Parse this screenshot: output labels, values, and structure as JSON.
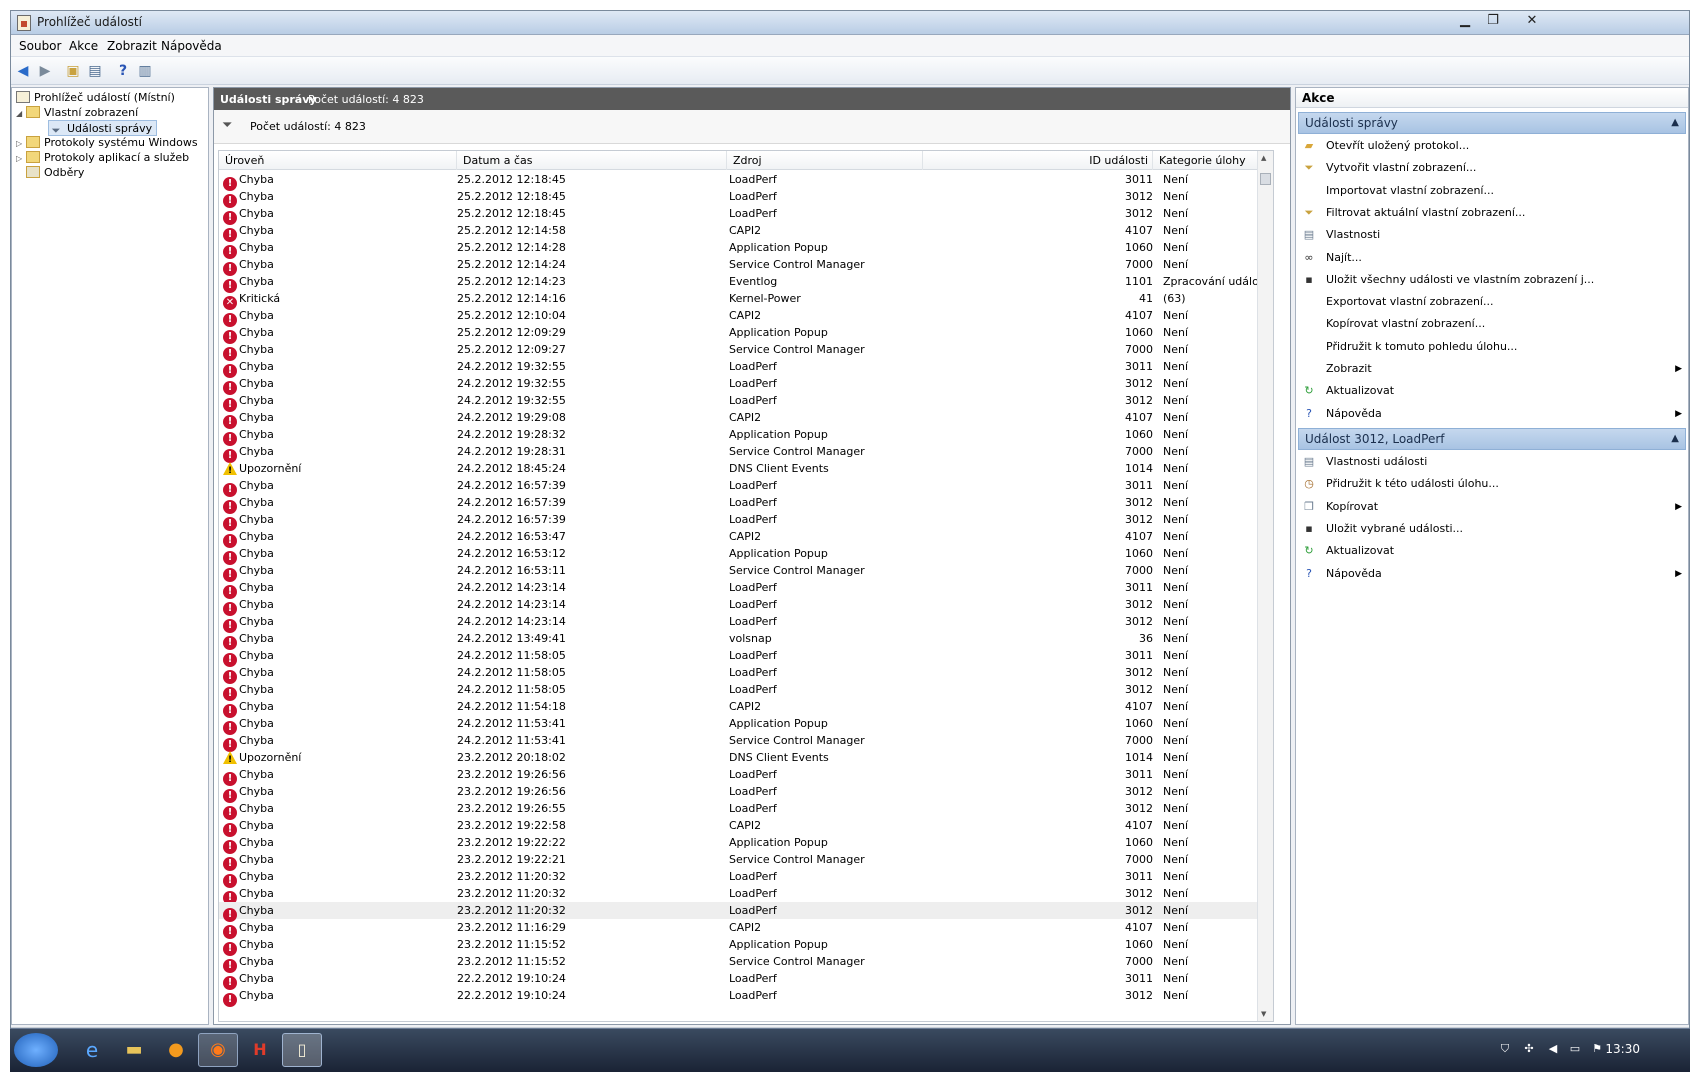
{
  "window": {
    "title": "Prohlížeč událostí",
    "minimize": "▁",
    "maximize": "❐",
    "close": "✕"
  },
  "menu": [
    "Soubor",
    "Akce",
    "Zobrazit",
    "Nápověda"
  ],
  "tree": {
    "root": "Prohlížeč událostí (Místní)",
    "custom_views": "Vlastní zobrazení",
    "admin_events": "Události správy",
    "windows_logs": "Protokoly systému Windows",
    "app_logs": "Protokoly aplikací a služeb",
    "subscriptions": "Odběry"
  },
  "middle": {
    "title": "Události správy",
    "count_header": "Počet událostí: 4 823",
    "filter_text": "Počet událostí: 4 823",
    "columns": [
      "Úroveň",
      "Datum a čas",
      "Zdroj",
      "ID události",
      "Kategorie úlohy"
    ]
  },
  "events": [
    {
      "level": "Chyba",
      "type": "err",
      "date": "25.2.2012 12:18:45",
      "source": "LoadPerf",
      "id": "3011",
      "category": "Není"
    },
    {
      "level": "Chyba",
      "type": "err",
      "date": "25.2.2012 12:18:45",
      "source": "LoadPerf",
      "id": "3012",
      "category": "Není"
    },
    {
      "level": "Chyba",
      "type": "err",
      "date": "25.2.2012 12:18:45",
      "source": "LoadPerf",
      "id": "3012",
      "category": "Není"
    },
    {
      "level": "Chyba",
      "type": "err",
      "date": "25.2.2012 12:14:58",
      "source": "CAPI2",
      "id": "4107",
      "category": "Není"
    },
    {
      "level": "Chyba",
      "type": "err",
      "date": "25.2.2012 12:14:28",
      "source": "Application Popup",
      "id": "1060",
      "category": "Není"
    },
    {
      "level": "Chyba",
      "type": "err",
      "date": "25.2.2012 12:14:24",
      "source": "Service Control Manager",
      "id": "7000",
      "category": "Není"
    },
    {
      "level": "Chyba",
      "type": "err",
      "date": "25.2.2012 12:14:23",
      "source": "Eventlog",
      "id": "1101",
      "category": "Zpracování události"
    },
    {
      "level": "Kritická",
      "type": "crit",
      "date": "25.2.2012 12:14:16",
      "source": "Kernel-Power",
      "id": "41",
      "category": "(63)"
    },
    {
      "level": "Chyba",
      "type": "err",
      "date": "25.2.2012 12:10:04",
      "source": "CAPI2",
      "id": "4107",
      "category": "Není"
    },
    {
      "level": "Chyba",
      "type": "err",
      "date": "25.2.2012 12:09:29",
      "source": "Application Popup",
      "id": "1060",
      "category": "Není"
    },
    {
      "level": "Chyba",
      "type": "err",
      "date": "25.2.2012 12:09:27",
      "source": "Service Control Manager",
      "id": "7000",
      "category": "Není"
    },
    {
      "level": "Chyba",
      "type": "err",
      "date": "24.2.2012 19:32:55",
      "source": "LoadPerf",
      "id": "3011",
      "category": "Není"
    },
    {
      "level": "Chyba",
      "type": "err",
      "date": "24.2.2012 19:32:55",
      "source": "LoadPerf",
      "id": "3012",
      "category": "Není"
    },
    {
      "level": "Chyba",
      "type": "err",
      "date": "24.2.2012 19:32:55",
      "source": "LoadPerf",
      "id": "3012",
      "category": "Není"
    },
    {
      "level": "Chyba",
      "type": "err",
      "date": "24.2.2012 19:29:08",
      "source": "CAPI2",
      "id": "4107",
      "category": "Není"
    },
    {
      "level": "Chyba",
      "type": "err",
      "date": "24.2.2012 19:28:32",
      "source": "Application Popup",
      "id": "1060",
      "category": "Není"
    },
    {
      "level": "Chyba",
      "type": "err",
      "date": "24.2.2012 19:28:31",
      "source": "Service Control Manager",
      "id": "7000",
      "category": "Není"
    },
    {
      "level": "Upozornění",
      "type": "warn",
      "date": "24.2.2012 18:45:24",
      "source": "DNS Client Events",
      "id": "1014",
      "category": "Není"
    },
    {
      "level": "Chyba",
      "type": "err",
      "date": "24.2.2012 16:57:39",
      "source": "LoadPerf",
      "id": "3011",
      "category": "Není"
    },
    {
      "level": "Chyba",
      "type": "err",
      "date": "24.2.2012 16:57:39",
      "source": "LoadPerf",
      "id": "3012",
      "category": "Není"
    },
    {
      "level": "Chyba",
      "type": "err",
      "date": "24.2.2012 16:57:39",
      "source": "LoadPerf",
      "id": "3012",
      "category": "Není"
    },
    {
      "level": "Chyba",
      "type": "err",
      "date": "24.2.2012 16:53:47",
      "source": "CAPI2",
      "id": "4107",
      "category": "Není"
    },
    {
      "level": "Chyba",
      "type": "err",
      "date": "24.2.2012 16:53:12",
      "source": "Application Popup",
      "id": "1060",
      "category": "Není"
    },
    {
      "level": "Chyba",
      "type": "err",
      "date": "24.2.2012 16:53:11",
      "source": "Service Control Manager",
      "id": "7000",
      "category": "Není"
    },
    {
      "level": "Chyba",
      "type": "err",
      "date": "24.2.2012 14:23:14",
      "source": "LoadPerf",
      "id": "3011",
      "category": "Není"
    },
    {
      "level": "Chyba",
      "type": "err",
      "date": "24.2.2012 14:23:14",
      "source": "LoadPerf",
      "id": "3012",
      "category": "Není"
    },
    {
      "level": "Chyba",
      "type": "err",
      "date": "24.2.2012 14:23:14",
      "source": "LoadPerf",
      "id": "3012",
      "category": "Není"
    },
    {
      "level": "Chyba",
      "type": "err",
      "date": "24.2.2012 13:49:41",
      "source": "volsnap",
      "id": "36",
      "category": "Není"
    },
    {
      "level": "Chyba",
      "type": "err",
      "date": "24.2.2012 11:58:05",
      "source": "LoadPerf",
      "id": "3011",
      "category": "Není"
    },
    {
      "level": "Chyba",
      "type": "err",
      "date": "24.2.2012 11:58:05",
      "source": "LoadPerf",
      "id": "3012",
      "category": "Není"
    },
    {
      "level": "Chyba",
      "type": "err",
      "date": "24.2.2012 11:58:05",
      "source": "LoadPerf",
      "id": "3012",
      "category": "Není"
    },
    {
      "level": "Chyba",
      "type": "err",
      "date": "24.2.2012 11:54:18",
      "source": "CAPI2",
      "id": "4107",
      "category": "Není"
    },
    {
      "level": "Chyba",
      "type": "err",
      "date": "24.2.2012 11:53:41",
      "source": "Application Popup",
      "id": "1060",
      "category": "Není"
    },
    {
      "level": "Chyba",
      "type": "err",
      "date": "24.2.2012 11:53:41",
      "source": "Service Control Manager",
      "id": "7000",
      "category": "Není"
    },
    {
      "level": "Upozornění",
      "type": "warn",
      "date": "23.2.2012 20:18:02",
      "source": "DNS Client Events",
      "id": "1014",
      "category": "Není"
    },
    {
      "level": "Chyba",
      "type": "err",
      "date": "23.2.2012 19:26:56",
      "source": "LoadPerf",
      "id": "3011",
      "category": "Není"
    },
    {
      "level": "Chyba",
      "type": "err",
      "date": "23.2.2012 19:26:56",
      "source": "LoadPerf",
      "id": "3012",
      "category": "Není"
    },
    {
      "level": "Chyba",
      "type": "err",
      "date": "23.2.2012 19:26:55",
      "source": "LoadPerf",
      "id": "3012",
      "category": "Není"
    },
    {
      "level": "Chyba",
      "type": "err",
      "date": "23.2.2012 19:22:58",
      "source": "CAPI2",
      "id": "4107",
      "category": "Není"
    },
    {
      "level": "Chyba",
      "type": "err",
      "date": "23.2.2012 19:22:22",
      "source": "Application Popup",
      "id": "1060",
      "category": "Není"
    },
    {
      "level": "Chyba",
      "type": "err",
      "date": "23.2.2012 19:22:21",
      "source": "Service Control Manager",
      "id": "7000",
      "category": "Není"
    },
    {
      "level": "Chyba",
      "type": "err",
      "date": "23.2.2012 11:20:32",
      "source": "LoadPerf",
      "id": "3011",
      "category": "Není"
    },
    {
      "level": "Chyba",
      "type": "err",
      "date": "23.2.2012 11:20:32",
      "source": "LoadPerf",
      "id": "3012",
      "category": "Není"
    },
    {
      "level": "Chyba",
      "type": "err",
      "date": "23.2.2012 11:20:32",
      "source": "LoadPerf",
      "id": "3012",
      "category": "Není",
      "highlighted": true
    },
    {
      "level": "Chyba",
      "type": "err",
      "date": "23.2.2012 11:16:29",
      "source": "CAPI2",
      "id": "4107",
      "category": "Není"
    },
    {
      "level": "Chyba",
      "type": "err",
      "date": "23.2.2012 11:15:52",
      "source": "Application Popup",
      "id": "1060",
      "category": "Není"
    },
    {
      "level": "Chyba",
      "type": "err",
      "date": "23.2.2012 11:15:52",
      "source": "Service Control Manager",
      "id": "7000",
      "category": "Není"
    },
    {
      "level": "Chyba",
      "type": "err",
      "date": "22.2.2012 19:10:24",
      "source": "LoadPerf",
      "id": "3011",
      "category": "Není"
    },
    {
      "level": "Chyba",
      "type": "err",
      "date": "22.2.2012 19:10:24",
      "source": "LoadPerf",
      "id": "3012",
      "category": "Není"
    }
  ],
  "actions": {
    "header": "Akce",
    "section1": {
      "title": "Události správy",
      "items": [
        {
          "label": "Otevřít uložený protokol...",
          "icon": "folder-open-icon"
        },
        {
          "label": "Vytvořit vlastní zobrazení...",
          "icon": "filter-icon"
        },
        {
          "label": "Importovat vlastní zobrazení...",
          "icon": "none"
        },
        {
          "label": "Filtrovat aktuální vlastní zobrazení...",
          "icon": "filter-icon"
        },
        {
          "label": "Vlastnosti",
          "icon": "properties-icon"
        },
        {
          "label": "Najít...",
          "icon": "binoculars-icon"
        },
        {
          "label": "Uložit všechny události ve vlastním zobrazení j...",
          "icon": "save-icon"
        },
        {
          "label": "Exportovat vlastní zobrazení...",
          "icon": "none"
        },
        {
          "label": "Kopírovat vlastní zobrazení...",
          "icon": "none"
        },
        {
          "label": "Přidružit k tomuto pohledu úlohu...",
          "icon": "none"
        },
        {
          "label": "Zobrazit",
          "icon": "none",
          "submenu": true
        },
        {
          "label": "Aktualizovat",
          "icon": "refresh-icon"
        },
        {
          "label": "Nápověda",
          "icon": "help-icon",
          "submenu": true
        }
      ]
    },
    "section2": {
      "title": "Událost 3012, LoadPerf",
      "items": [
        {
          "label": "Vlastnosti události",
          "icon": "properties-icon"
        },
        {
          "label": "Přidružit k této události úlohu...",
          "icon": "task-icon"
        },
        {
          "label": "Kopírovat",
          "icon": "copy-icon",
          "submenu": true
        },
        {
          "label": "Uložit vybrané události...",
          "icon": "save-icon"
        },
        {
          "label": "Aktualizovat",
          "icon": "refresh-icon"
        },
        {
          "label": "Nápověda",
          "icon": "help-icon",
          "submenu": true
        }
      ]
    }
  },
  "taskbar": {
    "clock": "13:30"
  },
  "colors": {
    "error": "#c8102e",
    "warning": "#f0c000",
    "section_header": "#b9d0ea",
    "pane_header": "#5a5a5a"
  }
}
